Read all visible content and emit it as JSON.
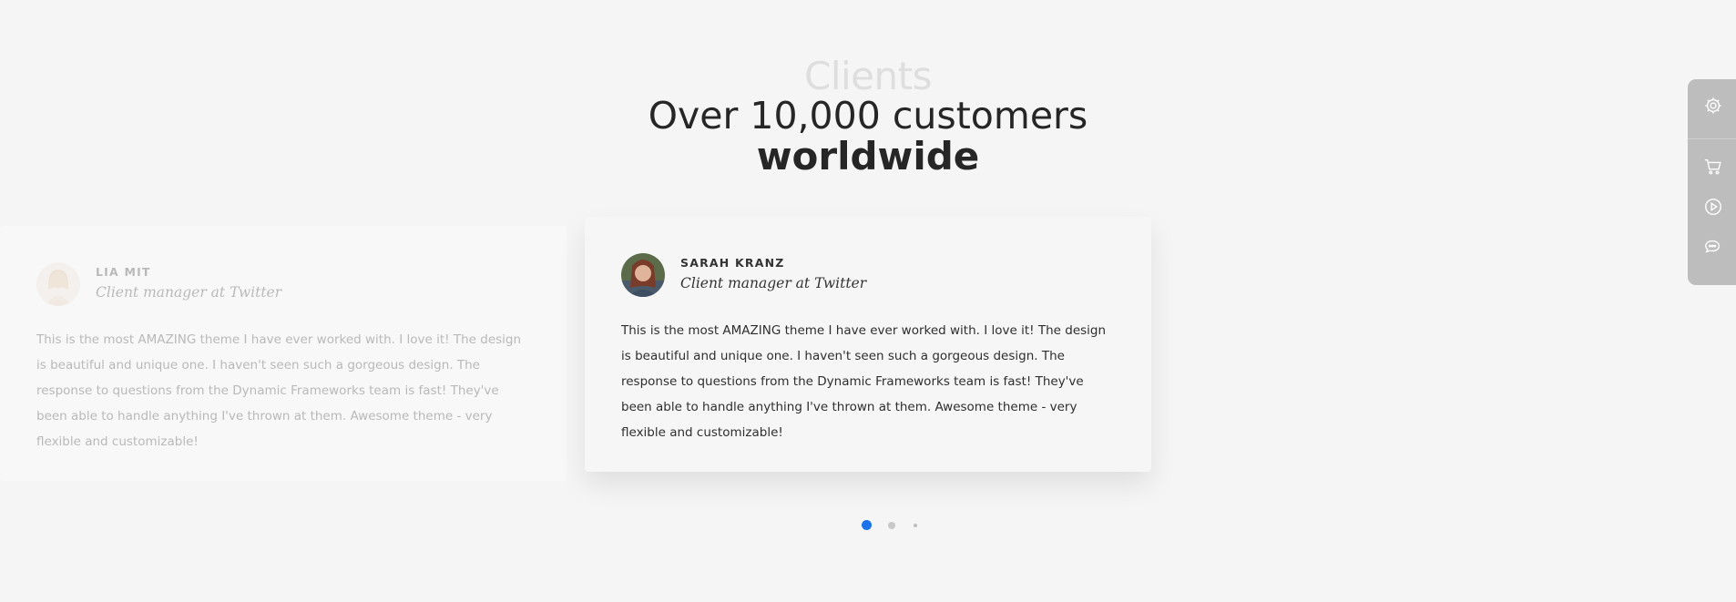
{
  "header": {
    "overline": "Clients",
    "title_line1": "Over 10,000 customers",
    "title_line2": "worldwide"
  },
  "testimonials": [
    {
      "name": "LIA MIT",
      "role": "Client manager at Twitter",
      "quote": "This is the most AMAZING theme I have ever worked with. I love it! The design is beautiful and unique one. I haven't seen such a gorgeous design. The response to questions from the Dynamic Frameworks team is fast! They've been able to handle anything I've thrown at them. Awesome theme - very flexible and customizable!"
    },
    {
      "name": "SARAH KRANZ",
      "role": "Client manager at Twitter",
      "quote": "This is the most AMAZING theme I have ever worked with. I love it! The design is beautiful and unique one. I haven't seen such a gorgeous design. The response to questions from the Dynamic Frameworks team is fast! They've been able to handle anything I've thrown at them. Awesome theme - very flexible and customizable!"
    }
  ],
  "carousel": {
    "active_index": 0,
    "dot_count": 3,
    "active_color": "#1a73e8"
  },
  "sidepanel": {
    "icons": [
      "gear-icon",
      "cart-icon",
      "play-circle-icon",
      "chat-icon"
    ]
  }
}
